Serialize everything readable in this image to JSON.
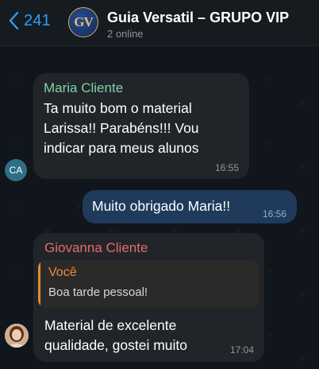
{
  "header": {
    "back_count": "241",
    "group_avatar_text": "GV",
    "title": "Guia Versatil – GRUPO VIP",
    "status": "2 online"
  },
  "messages": [
    {
      "sender": "Maria Cliente",
      "sender_color": "#7ed3a8",
      "avatar_initials": "CA",
      "text": "Ta muito bom o material Larissa!! Parabéns!!! Vou indicar para meus alunos",
      "time": "16:55",
      "direction": "incoming"
    },
    {
      "text": "Muito obrigado Maria!!",
      "time": "16:56",
      "direction": "outgoing"
    },
    {
      "sender": "Giovanna Cliente",
      "sender_color": "#e86a6a",
      "reply": {
        "name": "Você",
        "text": "Boa tarde pessoal!"
      },
      "text": "Material de excelente qualidade, gostei muito",
      "time": "17:04",
      "direction": "incoming"
    }
  ],
  "colors": {
    "accent": "#2f9df4",
    "incoming_bubble": "#212529",
    "outgoing_bubble": "#1f3a5a",
    "reply_accent": "#f08a3c"
  }
}
